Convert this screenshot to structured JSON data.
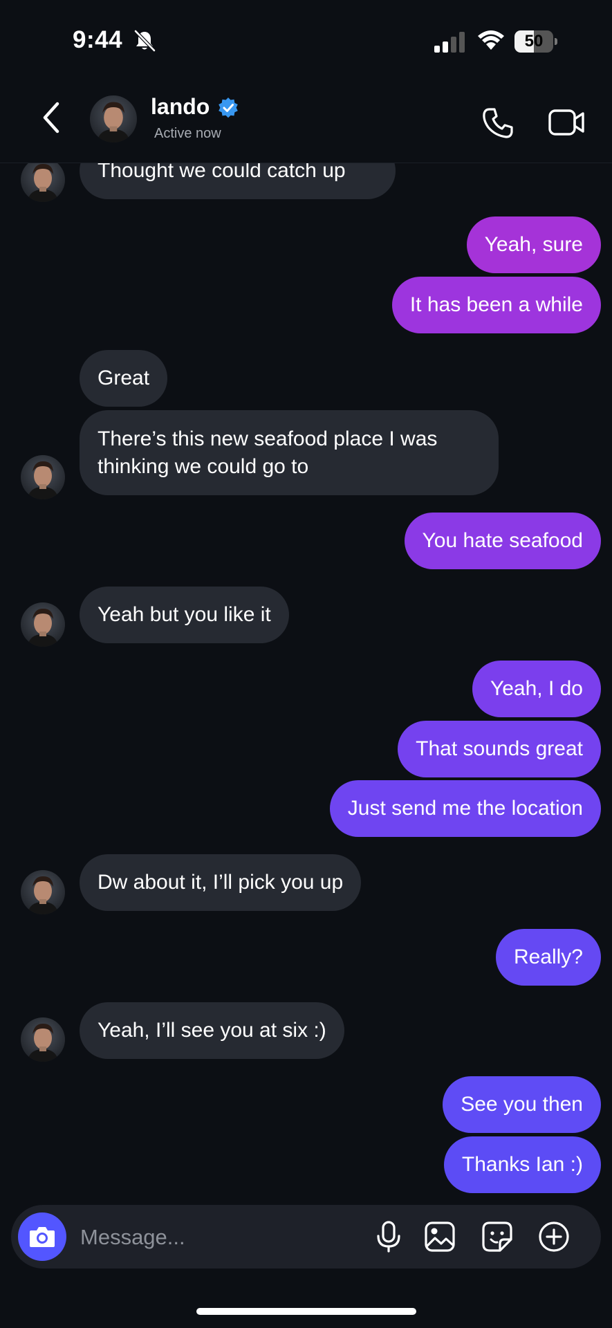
{
  "status_bar": {
    "time": "9:44",
    "battery_level": "50",
    "battery_fraction": 0.5
  },
  "header": {
    "contact_name": "lando",
    "status": "Active now"
  },
  "messages": [
    {
      "from": "them",
      "text": "Thought we could catch up"
    },
    {
      "from": "me",
      "text": "Yeah, sure"
    },
    {
      "from": "me",
      "text": "It has been a while"
    },
    {
      "from": "them",
      "text": "Great"
    },
    {
      "from": "them",
      "text": "There’s this new seafood place I was thinking we could go to"
    },
    {
      "from": "me",
      "text": "You hate seafood"
    },
    {
      "from": "them",
      "text": "Yeah but you like it"
    },
    {
      "from": "me",
      "text": "Yeah, I do"
    },
    {
      "from": "me",
      "text": "That sounds great"
    },
    {
      "from": "me",
      "text": "Just send me the location"
    },
    {
      "from": "them",
      "text": "Dw about it, I’ll pick you up"
    },
    {
      "from": "me",
      "text": "Really?"
    },
    {
      "from": "them",
      "text": "Yeah, I’ll see you at six :)"
    },
    {
      "from": "me",
      "text": "See you then"
    },
    {
      "from": "me",
      "text": "Thanks Ian :)"
    }
  ],
  "composer": {
    "placeholder": "Message..."
  },
  "icons": {
    "back": "chevron-left-icon",
    "verified": "verified-badge-icon",
    "call": "phone-icon",
    "video": "video-camera-icon",
    "camera": "camera-icon",
    "mic": "microphone-icon",
    "gallery": "image-icon",
    "sticker": "sticker-icon",
    "more": "plus-circle-icon"
  },
  "colors": {
    "background": "#0c0f14",
    "incoming_bubble": "#262a32",
    "outgoing_gradient_top": "#a133d9",
    "outgoing_gradient_bottom": "#5c4cf5",
    "verified": "#3897f0",
    "camera_button": "#5356ff"
  }
}
